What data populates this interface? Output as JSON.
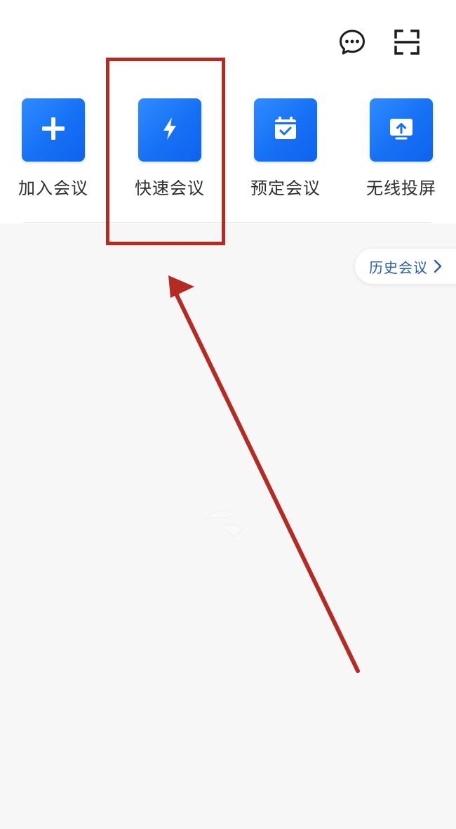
{
  "header": {
    "message_icon": "chat-bubble-icon",
    "scan_icon": "scan-icon"
  },
  "actions": [
    {
      "label": "加入会议",
      "icon": "plus-icon"
    },
    {
      "label": "快速会议",
      "icon": "lightning-icon"
    },
    {
      "label": "预定会议",
      "icon": "calendar-check-icon"
    },
    {
      "label": "无线投屏",
      "icon": "screen-cast-icon"
    }
  ],
  "history": {
    "label": "历史会议",
    "icon": "chevron-right-icon"
  },
  "colors": {
    "accent": "#1670f5",
    "history_text": "#2b5da8",
    "annotation": "#b52a23",
    "background": "#f7f7f7"
  }
}
